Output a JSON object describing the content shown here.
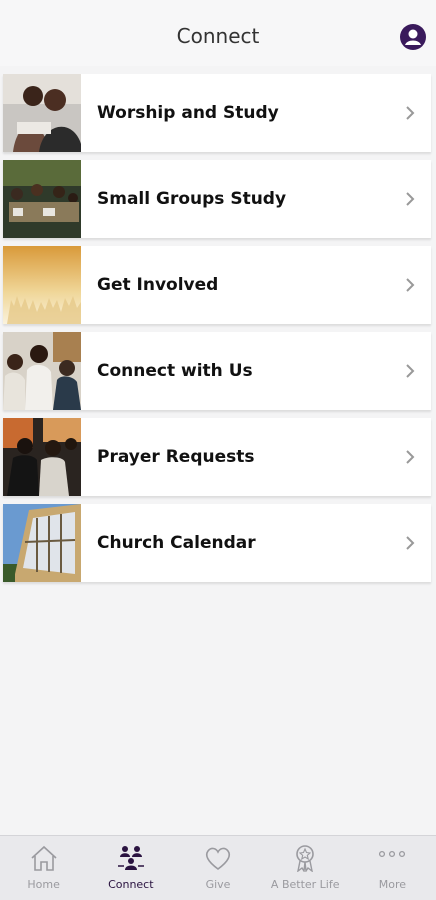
{
  "header": {
    "title": "Connect"
  },
  "items": [
    {
      "label": "Worship and Study"
    },
    {
      "label": "Small Groups Study"
    },
    {
      "label": "Get Involved"
    },
    {
      "label": "Connect with Us"
    },
    {
      "label": "Prayer Requests"
    },
    {
      "label": "Church Calendar"
    }
  ],
  "tabbar": {
    "tabs": [
      {
        "label": "Home",
        "icon": "home-icon"
      },
      {
        "label": "Connect",
        "icon": "people-icon"
      },
      {
        "label": "Give",
        "icon": "heart-icon"
      },
      {
        "label": "A Better Life",
        "icon": "ribbon-icon"
      },
      {
        "label": "More",
        "icon": "more-dots-icon"
      }
    ],
    "active_index": 1
  },
  "colors": {
    "accent": "#3a1a5c",
    "tab_inactive": "#9a9a9f",
    "background": "#f4f4f5"
  }
}
